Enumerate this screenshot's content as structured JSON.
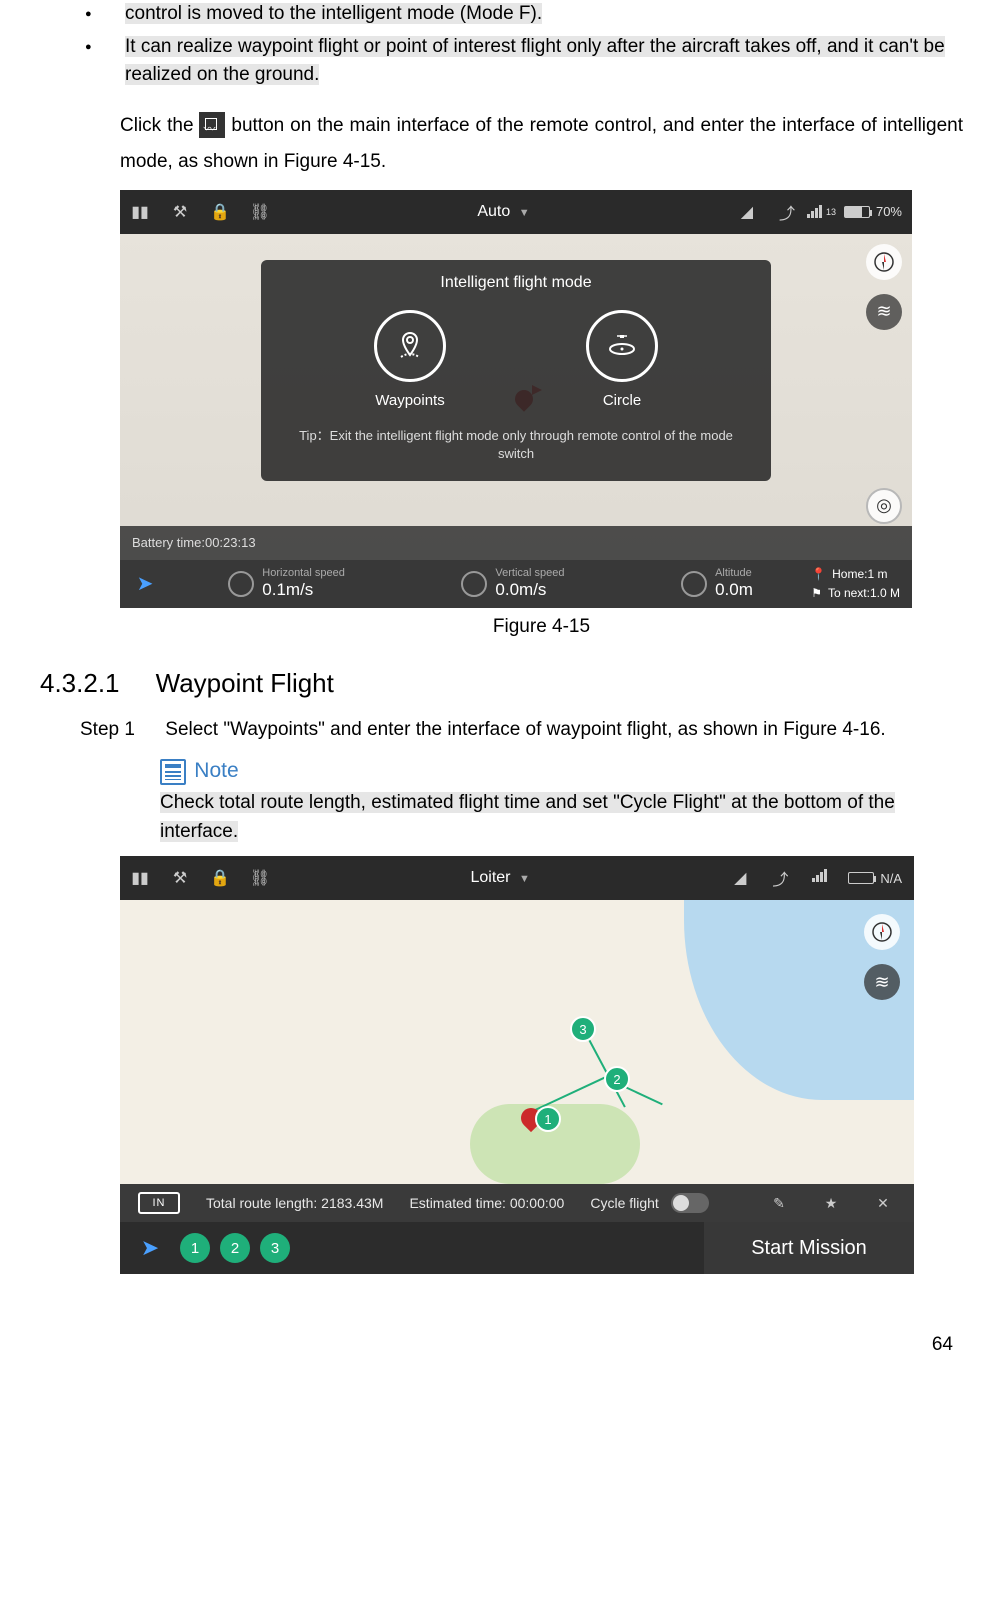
{
  "content": {
    "line1": "control is moved to the intelligent mode (Mode F).",
    "line2": "It can realize waypoint flight or point of interest flight only after the aircraft takes off, and it can't be realized on the ground.",
    "para_before": "Click the ",
    "para_after": " button on the main interface of the remote control, and enter the interface of intelligent mode, as shown in Figure 4-15.",
    "fig1_caption": "Figure 4-15",
    "section_no": "4.3.2.1",
    "section_title": "Waypoint Flight",
    "step1_label": "Step 1",
    "step1_text": "Select \"Waypoints\" and enter the interface of waypoint flight, as shown in Figure 4-16.",
    "note_label": "Note",
    "note_text": "Check total route length, estimated flight time and set \"Cycle Flight\" at the bottom of the interface.",
    "page_number": "64"
  },
  "fig1": {
    "topbar": {
      "mode": "Auto",
      "sat_count": "13",
      "battery_pct": "70%"
    },
    "modal": {
      "title": "Intelligent flight mode",
      "waypoints": "Waypoints",
      "circle": "Circle",
      "tip": "Tip：Exit the intelligent flight mode only through remote control of the mode switch"
    },
    "midbar": {
      "battery_time": "Battery time:00:23:13"
    },
    "botbar": {
      "hspeed_label": "Horizontal speed",
      "hspeed": "0.1m/s",
      "vspeed_label": "Vertical speed",
      "vspeed": "0.0m/s",
      "alt_label": "Altitude",
      "alt": "0.0m",
      "home": "Home:1 m",
      "tonext": "To next:1.0 M"
    }
  },
  "fig2": {
    "topbar": {
      "mode": "Loiter",
      "battery": "N/A"
    },
    "waypoints": [
      "1",
      "2",
      "3"
    ],
    "botinfo": {
      "in": "IN",
      "route": "Total route length: 2183.43M",
      "estimated": "Estimated time: 00:00:00",
      "cycle": "Cycle flight"
    },
    "pills": [
      "1",
      "2",
      "3"
    ],
    "start": "Start Mission"
  }
}
